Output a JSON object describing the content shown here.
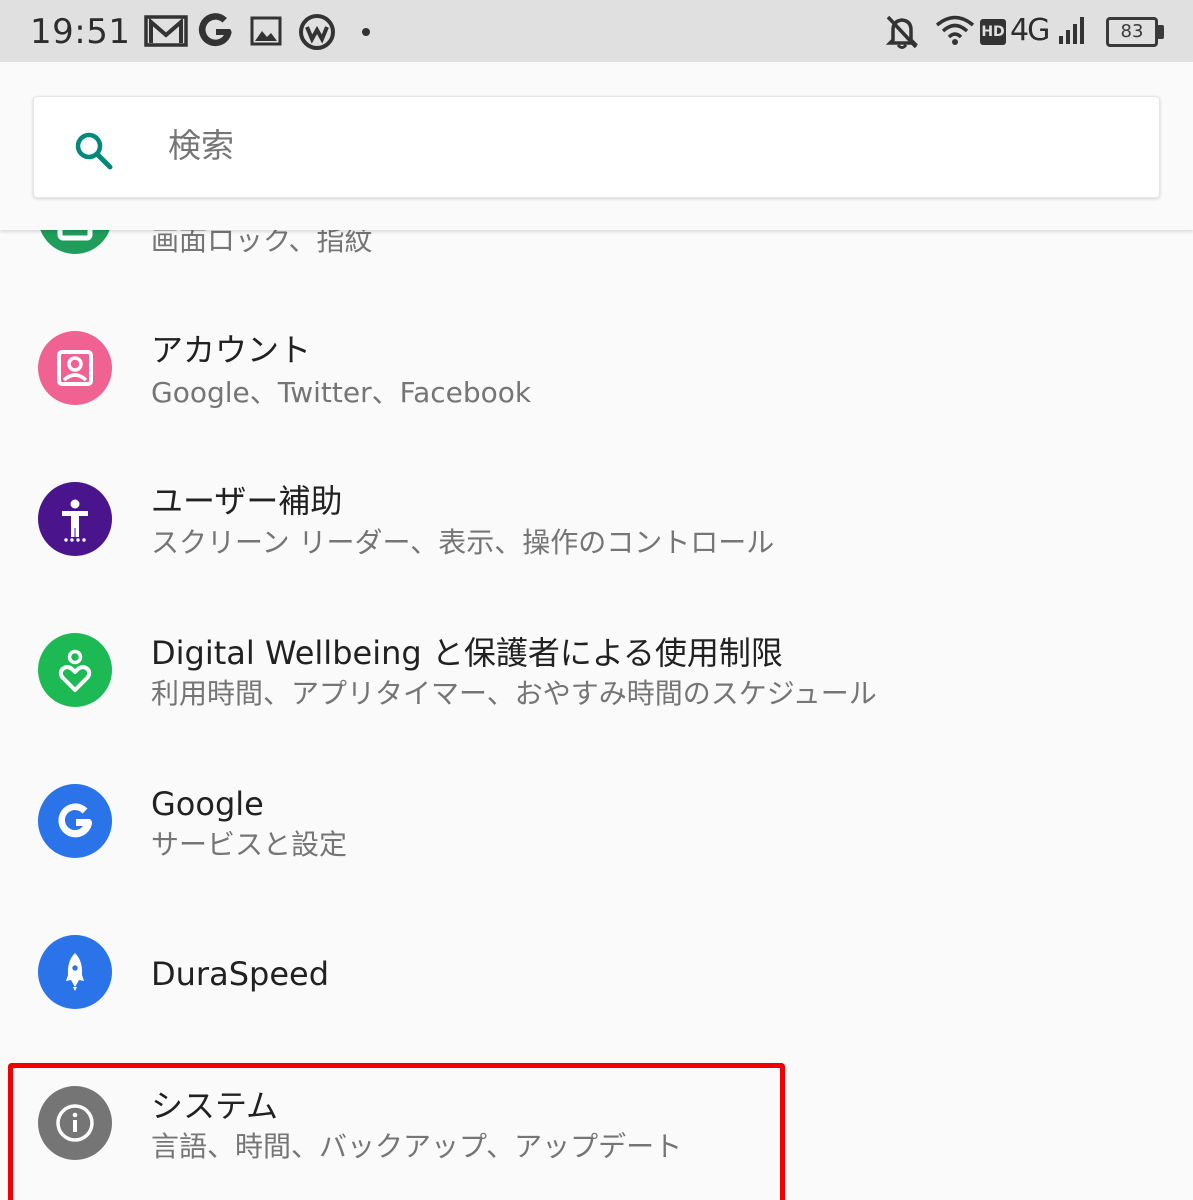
{
  "status_bar": {
    "time": "19:51",
    "network": "4G",
    "hd": "HD",
    "battery": "83"
  },
  "search": {
    "placeholder": "検索"
  },
  "settings": [
    {
      "id": "security",
      "title": "",
      "summary": "画面ロック、指紋",
      "icon": "lock-icon",
      "color": "#1e9e5a"
    },
    {
      "id": "accounts",
      "title": "アカウント",
      "summary": "Google、Twitter、Facebook",
      "icon": "account-box-icon",
      "color": "#f06292"
    },
    {
      "id": "accessibility",
      "title": "ユーザー補助",
      "summary": "スクリーン リーダー、表示、操作のコントロール",
      "icon": "accessibility-icon",
      "color": "#4a148c"
    },
    {
      "id": "wellbeing",
      "title": "Digital Wellbeing と保護者による使用制限",
      "summary": "利用時間、アプリタイマー、おやすみ時間のスケジュール",
      "icon": "wellbeing-icon",
      "color": "#1db954"
    },
    {
      "id": "google",
      "title": "Google",
      "summary": "サービスと設定",
      "icon": "google-icon",
      "color": "#2a73e8"
    },
    {
      "id": "duraspeed",
      "title": "DuraSpeed",
      "summary": "",
      "icon": "rocket-icon",
      "color": "#2a73e8"
    },
    {
      "id": "system",
      "title": "システム",
      "summary": "言語、時間、バックアップ、アップデート",
      "icon": "info-icon",
      "color": "#757575"
    }
  ],
  "highlight": {
    "target": "system",
    "color": "#f00000"
  }
}
